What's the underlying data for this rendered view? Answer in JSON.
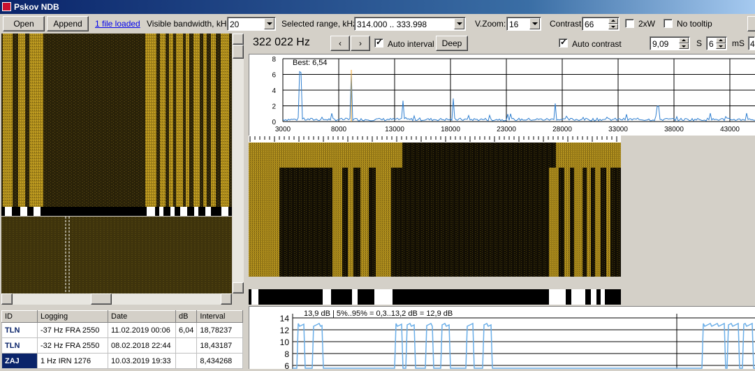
{
  "window": {
    "title": "Pskov NDB"
  },
  "toolbar": {
    "open_label": "Open",
    "append_label": "Append",
    "files_link": "1 file loaded",
    "bandwidth_label": "Visible bandwidth, kHz:",
    "bandwidth_value": "20",
    "range_label": "Selected range, kHz:",
    "range_value": "314.000 .. 333.998",
    "vzoom_label": "V.Zoom:",
    "vzoom_value": "16",
    "contrast_label": "Contrast:",
    "contrast_value": "66",
    "twoxw_label": "2xW",
    "twoxw_checked": false,
    "notooltip_label": "No tooltip",
    "notooltip_checked": false
  },
  "controls": {
    "frequency": "322 022 Hz",
    "prev_icon": "chevron-left-icon",
    "next_icon": "chevron-right-icon",
    "auto_interval_label": "Auto interval",
    "auto_interval_checked": true,
    "deep_label": "Deep",
    "auto_contrast_label": "Auto contrast",
    "auto_contrast_checked": true,
    "contrast_value": "9,09",
    "s_label": "S",
    "s_value": "6",
    "ms_label": "mS",
    "ms_value": "4"
  },
  "spectrum": {
    "best_label": "Best: 6,54",
    "y_ticks": [
      "8",
      "6",
      "4",
      "2",
      "0"
    ],
    "x_ticks": [
      "3000",
      "8000",
      "13000",
      "18000",
      "23000",
      "28000",
      "33000",
      "38000",
      "43000"
    ]
  },
  "level_chart": {
    "header": "13,9 dB | 5%..95% = 0,3..13,2 dB = 12,9 dB",
    "y_ticks": [
      "14",
      "12",
      "10",
      "8",
      "6"
    ]
  },
  "log_table": {
    "columns": [
      "ID",
      "Logging",
      "Date",
      "dB",
      "Interval"
    ],
    "rows": [
      {
        "id": "TLN",
        "logging": "-37 Hz FRA 2550",
        "date": "11.02.2019 00:06",
        "db": "6,04",
        "interval": "18,78237"
      },
      {
        "id": "TLN",
        "logging": "-32 Hz FRA 2550",
        "date": "08.02.2018 22:44",
        "db": "",
        "interval": "18,43187"
      },
      {
        "id": "ZAJ",
        "logging": "1 Hz IRN 1276",
        "date": "10.03.2019 19:33",
        "db": "",
        "interval": "8,434268"
      }
    ]
  },
  "colors": {
    "waterfall_bg": "#1a1508",
    "waterfall_band": "#b8961a",
    "spectrum_line": "#2f7fd0",
    "marker_orange": "#f0a020",
    "selected_row": "#0a246a"
  }
}
